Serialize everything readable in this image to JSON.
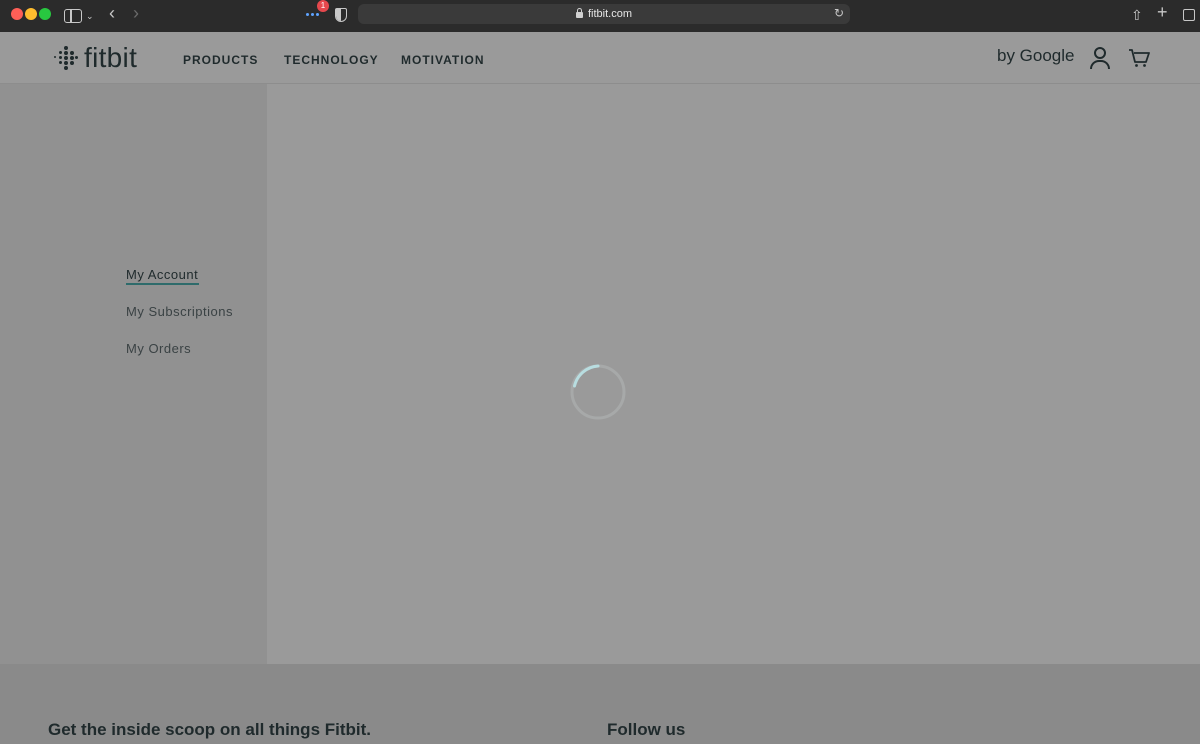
{
  "browser": {
    "url": "fitbit.com",
    "extension_badge": "1"
  },
  "header": {
    "logo_text": "fitbit",
    "nav": [
      {
        "label": "PRODUCTS"
      },
      {
        "label": "TECHNOLOGY"
      },
      {
        "label": "MOTIVATION"
      }
    ],
    "brand_suffix": "by Google"
  },
  "sidebar": {
    "items": [
      {
        "label": "My Account",
        "active": true
      },
      {
        "label": "My Subscriptions",
        "active": false
      },
      {
        "label": "My Orders",
        "active": false
      }
    ]
  },
  "footer": {
    "newsletter_heading": "Get the inside scoop on all things Fitbit.",
    "social_heading": "Follow us"
  },
  "colors": {
    "accent": "#2e6b6b",
    "spinner": "#b8dde0",
    "text": "#1f2a2c"
  }
}
